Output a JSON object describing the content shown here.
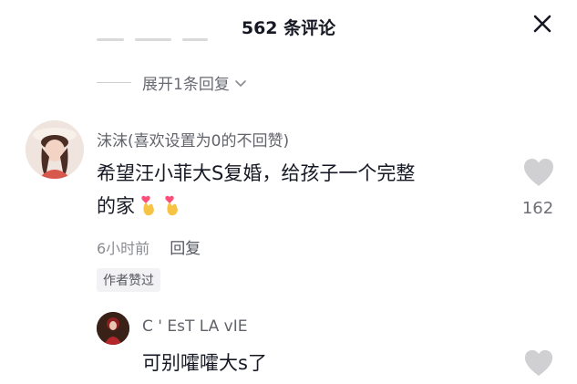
{
  "header": {
    "title": "562 条评论"
  },
  "thread": {
    "expand_label": "展开1条回复"
  },
  "comment": {
    "username": "沫沫(喜欢设置为0的不回赞)",
    "text_line1": "希望汪小菲大S复婚，给孩子一个完整",
    "text_line2": "的家",
    "like_count": "162",
    "time": "6小时前",
    "reply_label": "回复",
    "author_badge": "作者赞过"
  },
  "reply": {
    "username": "C ' EsT LA vIE",
    "text": "可别嚯嚯大s了"
  },
  "colors": {
    "like_heart": "#d0d0d3",
    "text": "#161823",
    "muted": "#8a8b91"
  }
}
